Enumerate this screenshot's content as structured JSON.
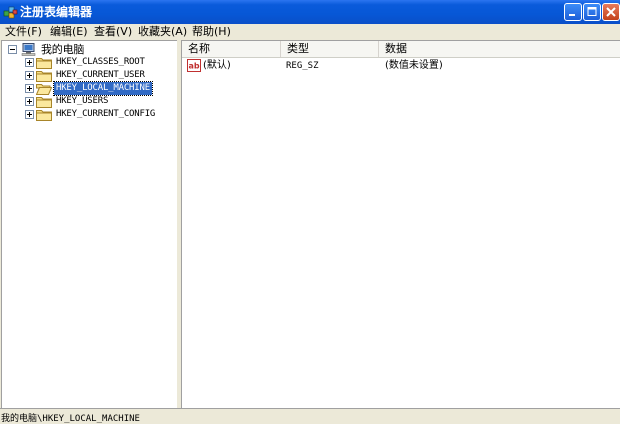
{
  "window": {
    "title": "注册表编辑器"
  },
  "menubar": {
    "items": [
      {
        "label": "文件(F)"
      },
      {
        "label": "编辑(E)"
      },
      {
        "label": "查看(V)"
      },
      {
        "label": "收藏夹(A)"
      },
      {
        "label": "帮助(H)"
      }
    ]
  },
  "tree": {
    "root": {
      "label": "我的电脑",
      "expander": "minus"
    },
    "children": [
      {
        "label": "HKEY_CLASSES_ROOT",
        "expander": "plus",
        "selected": false
      },
      {
        "label": "HKEY_CURRENT_USER",
        "expander": "plus",
        "selected": false
      },
      {
        "label": "HKEY_LOCAL_MACHINE",
        "expander": "plus",
        "selected": true
      },
      {
        "label": "HKEY_USERS",
        "expander": "plus",
        "selected": false
      },
      {
        "label": "HKEY_CURRENT_CONFIG",
        "expander": "plus",
        "selected": false
      }
    ]
  },
  "list": {
    "columns": [
      "名称",
      "类型",
      "数据"
    ],
    "rows": [
      {
        "name": "(默认)",
        "type": "REG_SZ",
        "data": "(数值未设置)",
        "icon": "string-value-icon"
      }
    ]
  },
  "statusbar": {
    "text": "我的电脑\\HKEY_LOCAL_MACHINE"
  },
  "colors": {
    "titlebar": "#0757D6",
    "selection": "#316AC5",
    "chrome": "#ECE9D8"
  }
}
